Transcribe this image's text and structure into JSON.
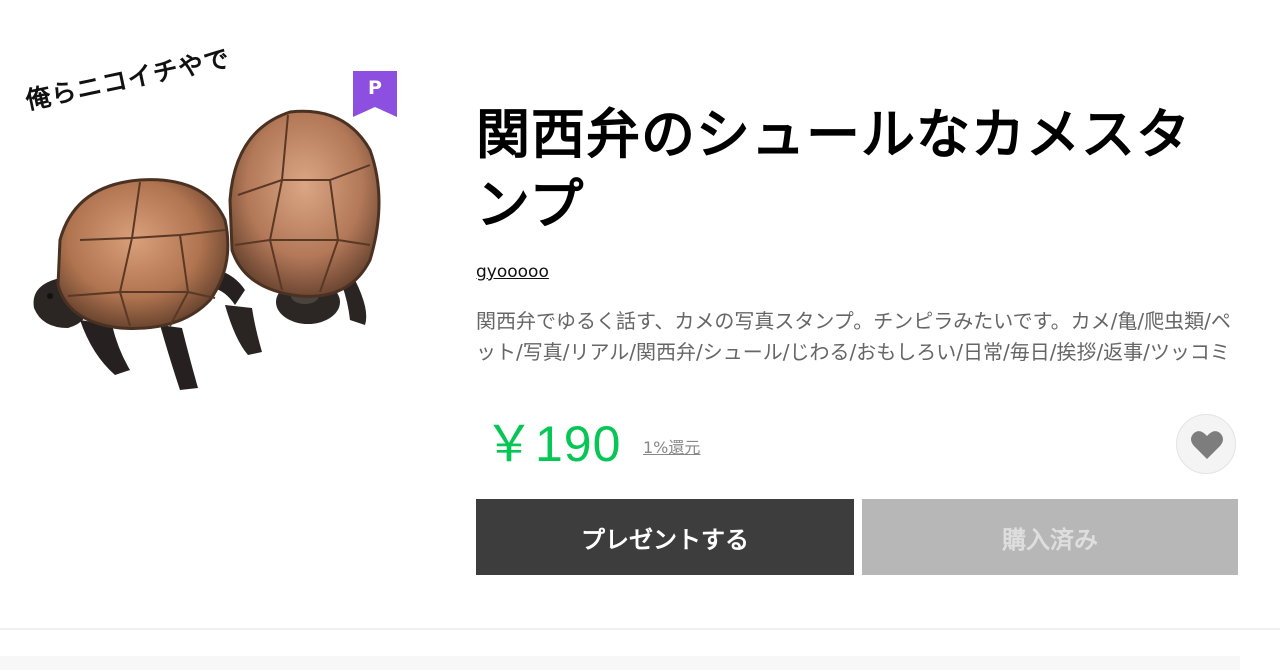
{
  "sticker": {
    "image_caption": "俺らニコイチやで",
    "premium_badge_letter": "P",
    "premium_badge_color": "#8c4fe0"
  },
  "product": {
    "title": "関西弁のシュールなカメスタンプ",
    "author": "gyooooo",
    "description": "関西弁でゆるく話す、カメの写真スタンプ。チンピラみたいです。カメ/亀/爬虫類/ペット/写真/リアル/関西弁/シュール/じわる/おもしろい/日常/毎日/挨拶/返事/ツッコミ",
    "price": "￥190",
    "price_color": "#06c755",
    "cashback": "1%還元"
  },
  "actions": {
    "favorite_icon": "heart-icon",
    "present_label": "プレゼントする",
    "purchased_label": "購入済み"
  }
}
